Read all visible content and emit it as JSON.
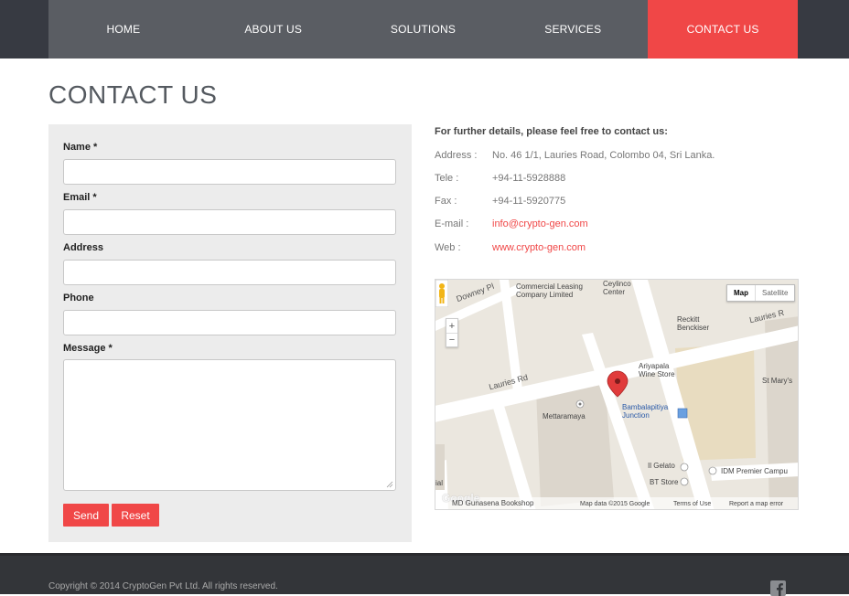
{
  "nav": {
    "items": [
      {
        "label": "HOME"
      },
      {
        "label": "ABOUT US"
      },
      {
        "label": "SOLUTIONS"
      },
      {
        "label": "SERVICES"
      },
      {
        "label": "CONTACT US",
        "active": true
      }
    ]
  },
  "page": {
    "title": "CONTACT US"
  },
  "form": {
    "name_label": "Name *",
    "email_label": "Email *",
    "address_label": "Address",
    "phone_label": "Phone",
    "message_label": "Message *",
    "name_value": "",
    "email_value": "",
    "address_value": "",
    "phone_value": "",
    "message_value": "",
    "send_label": "Send",
    "reset_label": "Reset"
  },
  "contact": {
    "heading": "For further details, please feel free to contact us:",
    "address_key": "Address :",
    "address_value": "No. 46 1/1, Lauries Road, Colombo 04, Sri Lanka.",
    "tele_key": "Tele :",
    "tele_value": "+94-11-5928888",
    "fax_key": "Fax :",
    "fax_value": "+94-11-5920775",
    "email_key": "E-mail :",
    "email_value": "info@crypto-gen.com",
    "web_key": "Web :",
    "web_value": "www.crypto-gen.com"
  },
  "map": {
    "map_button": "Map",
    "satellite_button": "Satellite",
    "zoom_in": "+",
    "zoom_out": "−",
    "labels": {
      "downey": "Downey Pl",
      "ccl": "Commercial Leasing\nCompany Limited",
      "ceylinco": "Ceylinco\nCenter",
      "reckitt": "Reckitt\nBenckiser",
      "lauries_r1": "Lauries Rd",
      "lauries_r2": "Lauries R",
      "ariyapala": "Ariyapala\nWine Store",
      "stmarys": "St Mary's",
      "bambalapitiya": "Bambalapitiya\nJunction",
      "mettaramaya": "Mettaramaya",
      "ilgelato": "Il Gelato",
      "btstore": "BT Store",
      "idm": "IDM Premier Campu",
      "gunasena": "MD Gunasena Bookshop",
      "ial": "ial"
    },
    "google": "Google",
    "map_data": "Map data ©2015 Google",
    "terms": "Terms of Use",
    "report": "Report a map error"
  },
  "footer": {
    "copyright": "Copyright © 2014 CryptoGen Pvt Ltd. All rights reserved."
  },
  "colors": {
    "accent": "#f04747",
    "nav_bg": "#5a5d63",
    "footer_bg": "#333539"
  }
}
